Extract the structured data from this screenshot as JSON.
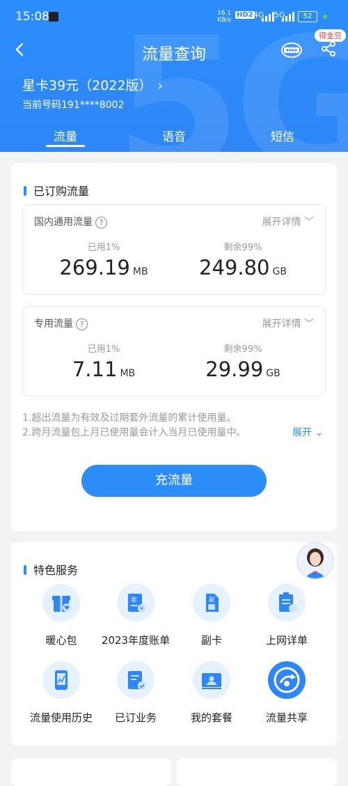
{
  "status": {
    "time": "15:08",
    "net_speed": "16.1",
    "net_unit": "KB/s",
    "hd": "HD2",
    "sig1": "4G",
    "sig2": "5G",
    "battery": "52"
  },
  "header": {
    "title": "流量查询",
    "coins_badge": "得金豆",
    "plan_name": "星卡39元（2022版）",
    "phone": "当前号码191****8002",
    "tabs": [
      {
        "label": "流量",
        "active": true
      },
      {
        "label": "语音",
        "active": false
      },
      {
        "label": "短信",
        "active": false
      }
    ]
  },
  "subscribed": {
    "title": "已订购流量",
    "panels": [
      {
        "name": "国内通用流量",
        "help": "?",
        "more": "展开详情",
        "used_label": "已用1%",
        "used_value": "269.19",
        "used_unit": "MB",
        "left_label": "剩余99%",
        "left_value": "249.80",
        "left_unit": "GB"
      },
      {
        "name": "专用流量",
        "help": "?",
        "more": "展开详情",
        "used_label": "已用1%",
        "used_value": "7.11",
        "used_unit": "MB",
        "left_label": "剩余99%",
        "left_value": "29.99",
        "left_unit": "GB"
      }
    ],
    "note1": "1.超出流量为有效及过期套外流量的累计使用量。",
    "note2": "2.跨月流量包上月已使用量会计入当月已使用量中。",
    "expand": "展开",
    "cta": "充流量"
  },
  "services": {
    "title": "特色服务",
    "items": [
      {
        "label": "暖心包",
        "icon": "gift-icon"
      },
      {
        "label": "2023年度账单",
        "icon": "annual-bill-icon"
      },
      {
        "label": "副卡",
        "icon": "sim-card-icon"
      },
      {
        "label": "上网详单",
        "icon": "data-detail-icon"
      },
      {
        "label": "流量使用历史",
        "icon": "usage-history-icon"
      },
      {
        "label": "已订业务",
        "icon": "subscribed-services-icon"
      },
      {
        "label": "我的套餐",
        "icon": "my-plan-icon"
      },
      {
        "label": "流量共享",
        "icon": "data-share-icon"
      }
    ]
  },
  "colors": {
    "brand": "#2b8dfb",
    "background": "#f2f3f5"
  }
}
